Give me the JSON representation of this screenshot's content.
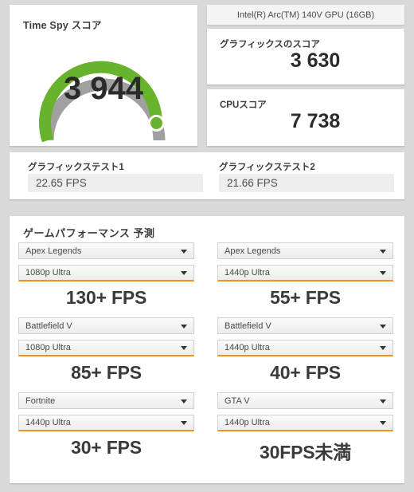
{
  "score_card": {
    "title": "Time Spy スコア",
    "value": "3 944",
    "gauge": {
      "percent": 80,
      "arc_color": "#67b32e",
      "track_color": "#a0a0a0",
      "marker_color": "#67b32e"
    }
  },
  "gpu_header": {
    "label": "Intel(R) Arc(TM) 140V GPU (16GB)"
  },
  "graphics_score": {
    "title": "グラフィックスのスコア",
    "value": "3 630"
  },
  "cpu_score": {
    "title": "CPUスコア",
    "value": "7 738"
  },
  "graphics_tests": [
    {
      "label": "グラフィックステスト1",
      "value": "22.65 FPS"
    },
    {
      "label": "グラフィックステスト2",
      "value": "21.66 FPS"
    }
  ],
  "game_performance": {
    "title": "ゲームパフォーマンス 予測",
    "columns": [
      {
        "side": "left",
        "blocks": [
          {
            "game": "Apex Legends",
            "preset": "1080p Ultra",
            "fps": "130+ FPS"
          },
          {
            "game": "Battlefield V",
            "preset": "1080p Ultra",
            "fps": "85+ FPS"
          },
          {
            "game": "Fortnite",
            "preset": "1440p Ultra",
            "fps": "30+ FPS"
          }
        ]
      },
      {
        "side": "right",
        "blocks": [
          {
            "game": "Apex Legends",
            "preset": "1440p Ultra",
            "fps": "55+ FPS"
          },
          {
            "game": "Battlefield V",
            "preset": "1440p Ultra",
            "fps": "40+ FPS"
          },
          {
            "game": "GTA V",
            "preset": "1440p Ultra",
            "fps": "30FPS未満"
          }
        ]
      }
    ]
  },
  "colors": {
    "accent_orange": "#f0931d",
    "score_green": "#67b32e",
    "page_background": "#d9d9d9"
  }
}
